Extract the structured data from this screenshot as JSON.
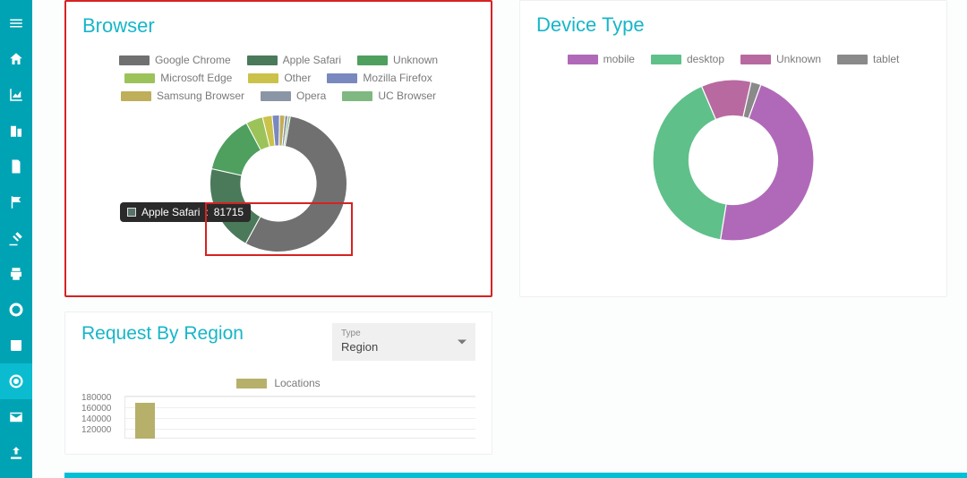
{
  "sidebar": {
    "items": [
      {
        "name": "menu-icon"
      },
      {
        "name": "home-icon"
      },
      {
        "name": "chart-icon"
      },
      {
        "name": "buildings-icon"
      },
      {
        "name": "document-icon"
      },
      {
        "name": "flag-icon"
      },
      {
        "name": "gavel-icon"
      },
      {
        "name": "print-icon"
      },
      {
        "name": "lifebuoy-icon"
      },
      {
        "name": "news-icon"
      },
      {
        "name": "target-icon",
        "active": true
      },
      {
        "name": "mail-icon"
      },
      {
        "name": "upload-icon"
      }
    ]
  },
  "browser_card": {
    "title": "Browser",
    "tooltip_label": "Apple Safari",
    "tooltip_value": "81715",
    "legend": [
      {
        "label": "Google Chrome",
        "color": "#707070"
      },
      {
        "label": "Apple Safari",
        "color": "#4a7a5a"
      },
      {
        "label": "Unknown",
        "color": "#4f9f5f"
      },
      {
        "label": "Microsoft Edge",
        "color": "#9cc35a"
      },
      {
        "label": "Other",
        "color": "#cac24a"
      },
      {
        "label": "Mozilla Firefox",
        "color": "#7a88c0"
      },
      {
        "label": "Samsung Browser",
        "color": "#bfae5a"
      },
      {
        "label": "Opera",
        "color": "#8a96a6"
      },
      {
        "label": "UC Browser",
        "color": "#7fb880"
      }
    ]
  },
  "device_card": {
    "title": "Device Type",
    "legend": [
      {
        "label": "mobile",
        "color": "#b069b8"
      },
      {
        "label": "desktop",
        "color": "#5fc08a"
      },
      {
        "label": "Unknown",
        "color": "#b86aa0"
      },
      {
        "label": "tablet",
        "color": "#8a8a8a"
      }
    ]
  },
  "region_card": {
    "title": "Request By Region",
    "type_label": "Type",
    "type_value": "Region",
    "legend_label": "Locations",
    "y_ticks": [
      "180000",
      "160000",
      "140000",
      "120000"
    ]
  },
  "chart_data": [
    {
      "type": "pie",
      "title": "Browser",
      "series": [
        {
          "name": "Browser",
          "values": [
            {
              "label": "Google Chrome",
              "value": 220000,
              "color": "#707070"
            },
            {
              "label": "Apple Safari",
              "value": 81715,
              "color": "#4a7a5a"
            },
            {
              "label": "Unknown",
              "value": 55000,
              "color": "#4f9f5f"
            },
            {
              "label": "Microsoft Edge",
              "value": 16000,
              "color": "#9cc35a"
            },
            {
              "label": "Other",
              "value": 9000,
              "color": "#cac24a"
            },
            {
              "label": "Mozilla Firefox",
              "value": 7000,
              "color": "#7a88c0"
            },
            {
              "label": "Samsung Browser",
              "value": 5000,
              "color": "#bfae5a"
            },
            {
              "label": "Opera",
              "value": 3000,
              "color": "#8a96a6"
            },
            {
              "label": "UC Browser",
              "value": 2000,
              "color": "#7fb880"
            }
          ]
        }
      ],
      "donut_inner_ratio": 0.55
    },
    {
      "type": "pie",
      "title": "Device Type",
      "series": [
        {
          "name": "Device Type",
          "values": [
            {
              "label": "mobile",
              "value": 47,
              "color": "#b069b8"
            },
            {
              "label": "desktop",
              "value": 41,
              "color": "#5fc08a"
            },
            {
              "label": "Unknown",
              "value": 10,
              "color": "#b86aa0"
            },
            {
              "label": "tablet",
              "value": 2,
              "color": "#8a8a8a"
            }
          ]
        }
      ],
      "donut_inner_ratio": 0.55
    },
    {
      "type": "bar",
      "title": "Request By Region",
      "categories": [
        "Locations"
      ],
      "values": [
        170000
      ],
      "ylabel": "",
      "ylim": [
        0,
        180000
      ],
      "legend": [
        "Locations"
      ]
    }
  ]
}
